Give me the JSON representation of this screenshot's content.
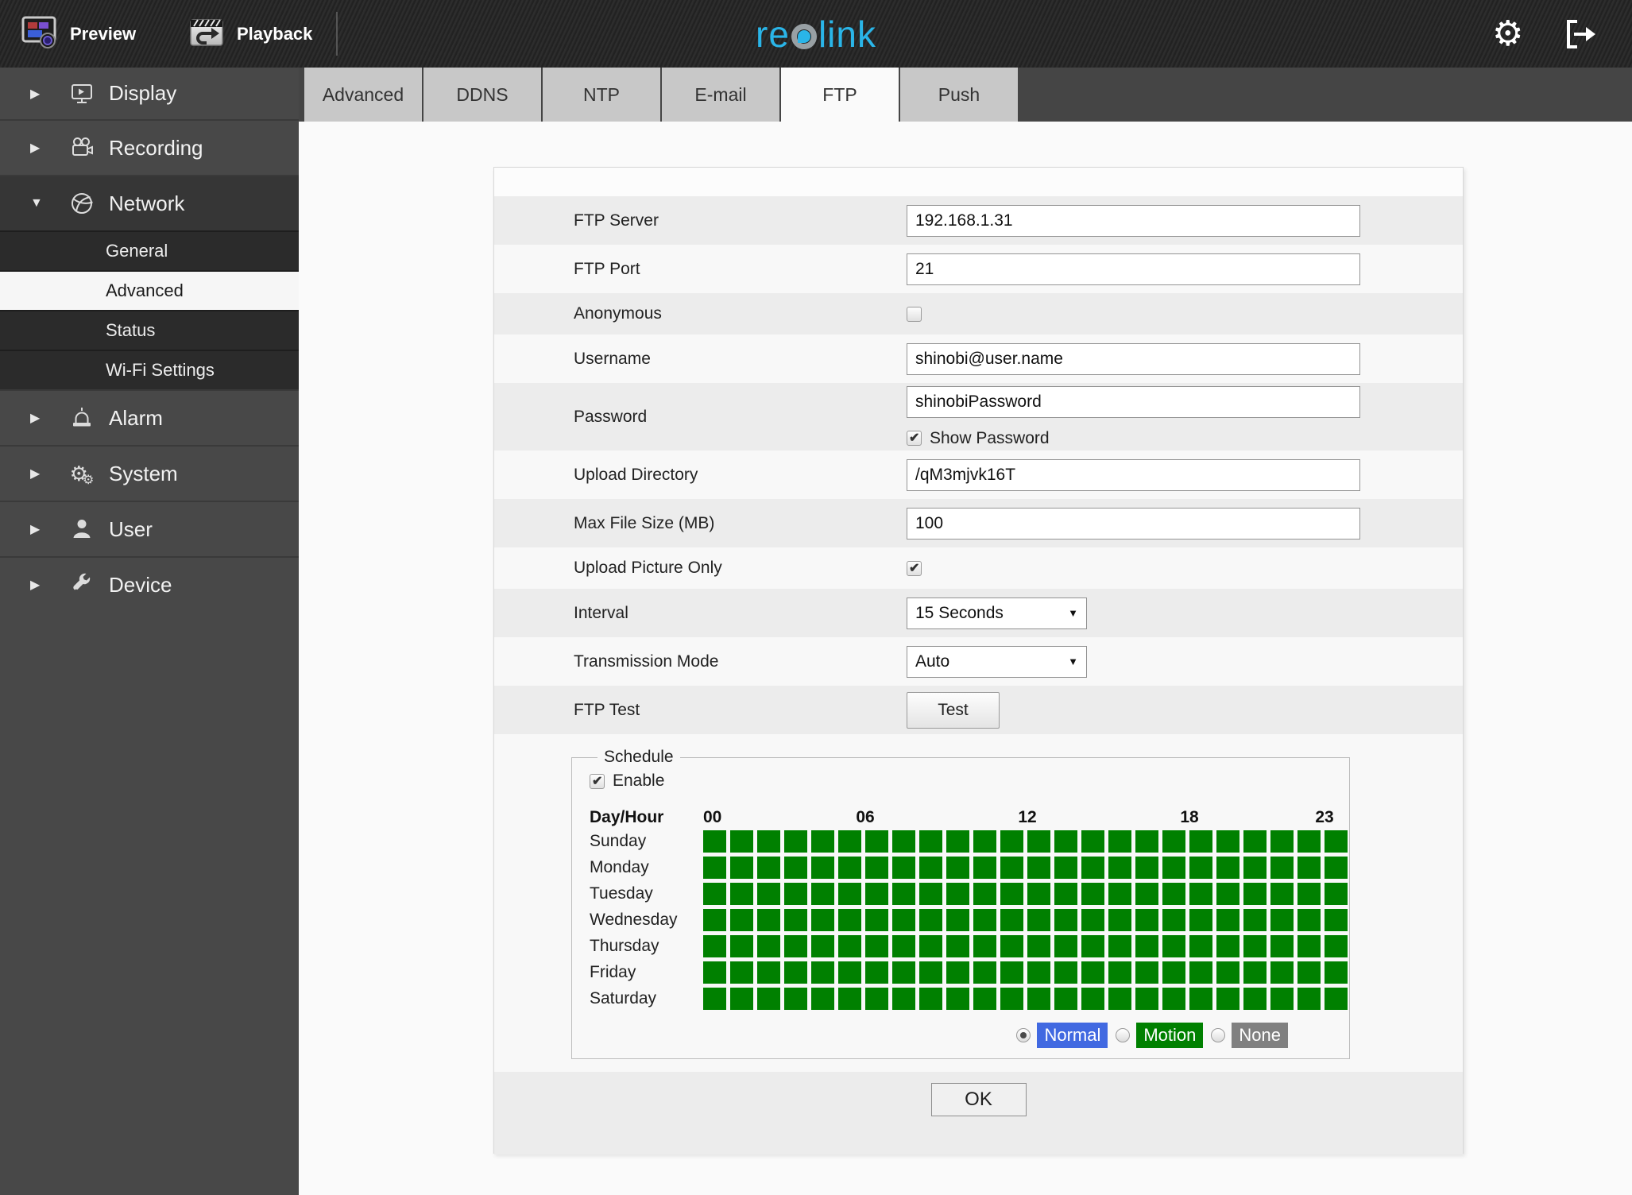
{
  "header": {
    "preview": "Preview",
    "playback": "Playback",
    "logo": {
      "part1": "re",
      "part2": "o",
      "part3": "link",
      "accent_color": "#2ab5e8"
    }
  },
  "sidebar": {
    "items": [
      {
        "id": "display",
        "label": "Display",
        "icon": "display-icon",
        "expanded": false
      },
      {
        "id": "recording",
        "label": "Recording",
        "icon": "recording-icon",
        "expanded": false
      },
      {
        "id": "network",
        "label": "Network",
        "icon": "network-icon",
        "expanded": true,
        "children": [
          {
            "id": "general",
            "label": "General",
            "active": false
          },
          {
            "id": "advanced",
            "label": "Advanced",
            "active": true
          },
          {
            "id": "status",
            "label": "Status",
            "active": false
          },
          {
            "id": "wifi",
            "label": "Wi-Fi Settings",
            "active": false
          }
        ]
      },
      {
        "id": "alarm",
        "label": "Alarm",
        "icon": "alarm-icon",
        "expanded": false
      },
      {
        "id": "system",
        "label": "System",
        "icon": "system-icon",
        "expanded": false
      },
      {
        "id": "user",
        "label": "User",
        "icon": "user-icon",
        "expanded": false
      },
      {
        "id": "device",
        "label": "Device",
        "icon": "device-icon",
        "expanded": false
      }
    ]
  },
  "tabs": {
    "items": [
      "Advanced",
      "DDNS",
      "NTP",
      "E-mail",
      "FTP",
      "Push"
    ],
    "active": "FTP"
  },
  "form": {
    "rows": [
      {
        "label": "FTP Server",
        "type": "text",
        "value": "192.168.1.31"
      },
      {
        "label": "FTP Port",
        "type": "text",
        "value": "21"
      },
      {
        "label": "Anonymous",
        "type": "checkbox",
        "checked": false
      },
      {
        "label": "Username",
        "type": "text",
        "value": "shinobi@user.name"
      },
      {
        "label": "Password",
        "type": "password",
        "value": "shinobiPassword",
        "extra_checkbox": {
          "label": "Show Password",
          "checked": true
        }
      },
      {
        "label": "Upload Directory",
        "type": "text",
        "value": "/qM3mjvk16T"
      },
      {
        "label": "Max File Size (MB)",
        "type": "text",
        "value": "100"
      },
      {
        "label": "Upload Picture Only",
        "type": "checkbox",
        "checked": true
      },
      {
        "label": "Interval",
        "type": "select",
        "value": "15 Seconds"
      },
      {
        "label": "Transmission Mode",
        "type": "select",
        "value": "Auto"
      },
      {
        "label": "FTP Test",
        "type": "button",
        "value": "Test"
      }
    ]
  },
  "schedule": {
    "legend": "Schedule",
    "enable_label": "Enable",
    "enabled": true,
    "corner_label": "Day/Hour",
    "hour_labels": [
      {
        "text": "00",
        "pos": 0
      },
      {
        "text": "06",
        "pos": 6
      },
      {
        "text": "12",
        "pos": 12
      },
      {
        "text": "18",
        "pos": 18
      },
      {
        "text": "23",
        "pos": 23
      }
    ],
    "days": [
      "Sunday",
      "Monday",
      "Tuesday",
      "Wednesday",
      "Thursday",
      "Friday",
      "Saturday"
    ],
    "hours_per_day": 24,
    "grid_fill": "motion",
    "cell_color": "#008000",
    "modes": [
      {
        "label": "Normal",
        "color": "#4169e1",
        "selected": true
      },
      {
        "label": "Motion",
        "color": "#008000",
        "selected": false
      },
      {
        "label": "None",
        "color": "#808080",
        "selected": false
      }
    ]
  },
  "footer": {
    "ok_label": "OK"
  }
}
